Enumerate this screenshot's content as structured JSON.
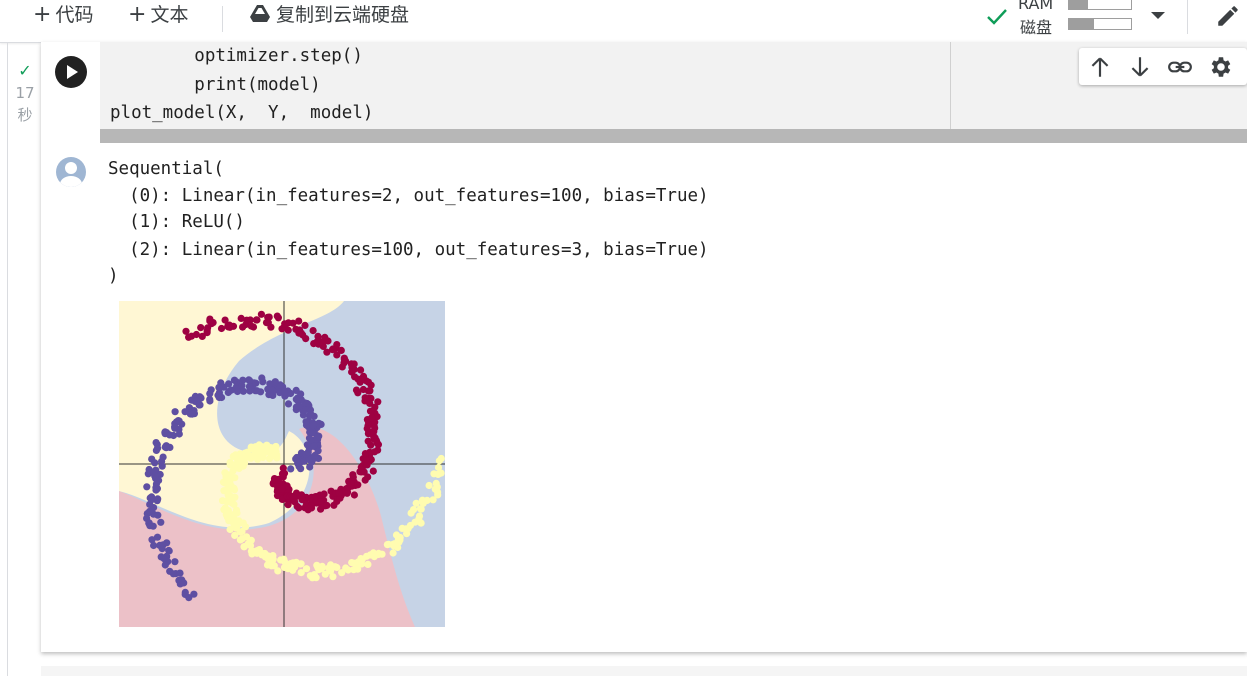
{
  "toolbar": {
    "add_code_label": "代码",
    "add_text_label": "文本",
    "copy_to_drive_label": "复制到云端硬盘",
    "ram_label": "RAM",
    "disk_label": "磁盘",
    "ram_usage": 0.3,
    "disk_usage": 0.4
  },
  "cell": {
    "exec_time_value": "17",
    "exec_time_unit": "秒",
    "code_lines": [
      "        optimizer.step()",
      "        print(model)",
      "plot_model(X,  Y,  model)"
    ],
    "output_lines": [
      "Sequential(",
      "  (0): Linear(in_features=2, out_features=100, bias=True)",
      "  (1): ReLU()",
      "  (2): Linear(in_features=100, out_features=3, bias=True)",
      ")"
    ]
  },
  "colors": {
    "class_yellow": "#fffcb0",
    "class_purple": "#5e4fa2",
    "class_red": "#9e0142",
    "region_yellow": "#fff7d4",
    "region_blue": "#c6d3e6",
    "region_pink": "#ecc1c8"
  }
}
